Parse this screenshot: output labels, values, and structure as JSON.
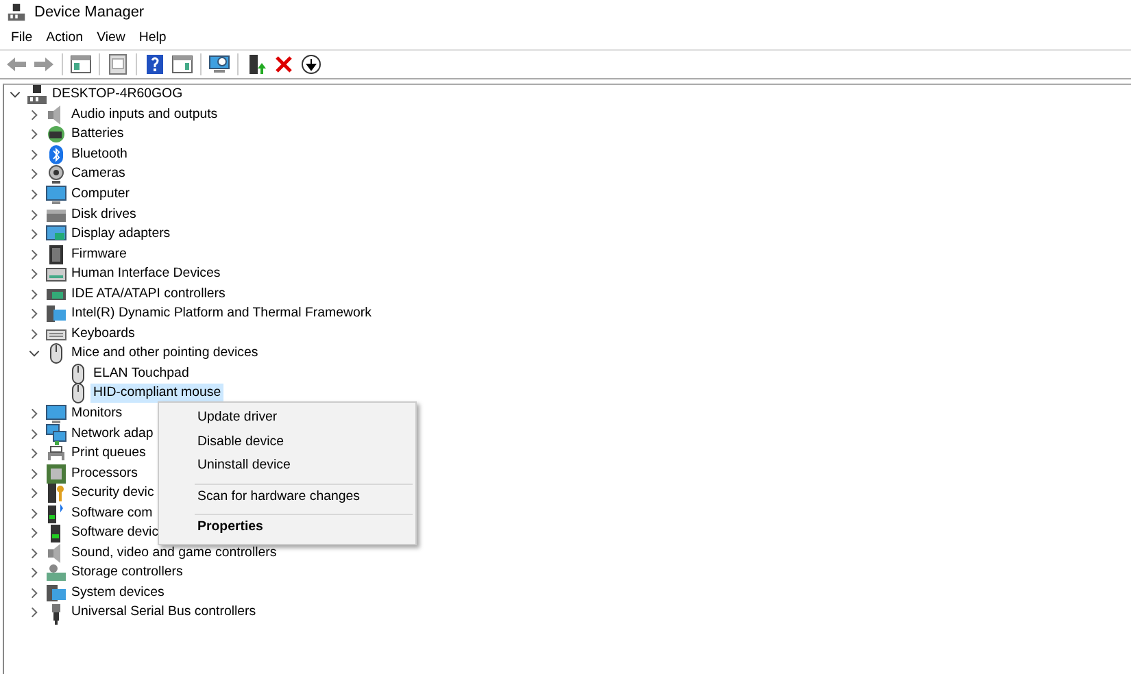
{
  "window": {
    "title": "Device Manager"
  },
  "menu_bar": [
    "File",
    "Action",
    "View",
    "Help"
  ],
  "tree": {
    "label": "DESKTOP-4R60GOG",
    "expanded": true,
    "children": [
      {
        "label": "Audio inputs and outputs",
        "expanded": false
      },
      {
        "label": "Batteries",
        "expanded": false
      },
      {
        "label": "Bluetooth",
        "expanded": false
      },
      {
        "label": "Cameras",
        "expanded": false
      },
      {
        "label": "Computer",
        "expanded": false
      },
      {
        "label": "Disk drives",
        "expanded": false
      },
      {
        "label": "Display adapters",
        "expanded": false
      },
      {
        "label": "Firmware",
        "expanded": false
      },
      {
        "label": "Human Interface Devices",
        "expanded": false
      },
      {
        "label": "IDE ATA/ATAPI controllers",
        "expanded": false
      },
      {
        "label": "Intel(R) Dynamic Platform and Thermal Framework",
        "expanded": false
      },
      {
        "label": "Keyboards",
        "expanded": false
      },
      {
        "label": "Mice and other pointing devices",
        "expanded": true,
        "children": [
          {
            "label": "ELAN Touchpad",
            "selected": false
          },
          {
            "label": "HID-compliant mouse",
            "selected": true
          }
        ]
      },
      {
        "label": "Monitors",
        "expanded": false
      },
      {
        "label": "Network adap",
        "expanded": false
      },
      {
        "label": "Print queues",
        "expanded": false
      },
      {
        "label": "Processors",
        "expanded": false
      },
      {
        "label": "Security devic",
        "expanded": false
      },
      {
        "label": "Software com",
        "expanded": false
      },
      {
        "label": "Software devic",
        "expanded": false
      },
      {
        "label": "Sound, video and game controllers",
        "expanded": false
      },
      {
        "label": "Storage controllers",
        "expanded": false
      },
      {
        "label": "System devices",
        "expanded": false
      },
      {
        "label": "Universal Serial Bus controllers",
        "expanded": false
      }
    ]
  },
  "context_menu": [
    {
      "label": "Update driver",
      "default": false,
      "separator_before": false
    },
    {
      "label": "Disable device",
      "default": false,
      "separator_before": false
    },
    {
      "label": "Uninstall device",
      "default": false,
      "separator_before": false
    },
    {
      "label": "Scan for hardware changes",
      "default": false,
      "separator_before": true
    },
    {
      "label": "Properties",
      "default": true,
      "separator_before": true
    }
  ]
}
